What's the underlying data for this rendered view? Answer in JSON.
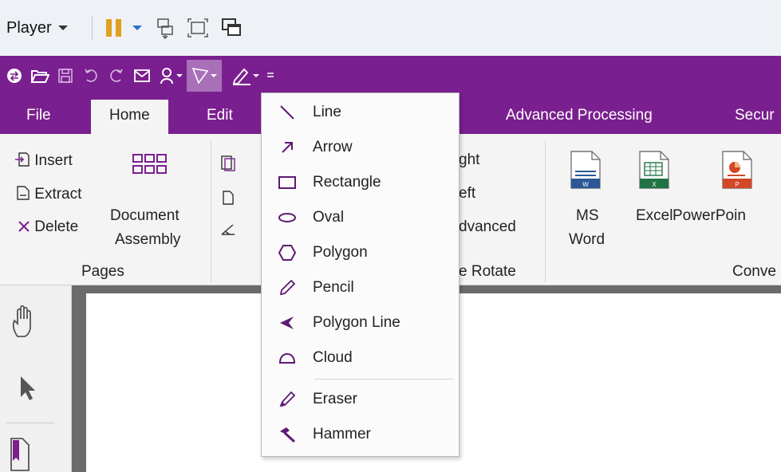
{
  "player_bar": {
    "player_label": "Player"
  },
  "tabs": [
    "File",
    "Home",
    "Edit",
    "Advanced Processing",
    "Secur"
  ],
  "ribbon": {
    "pages_group": {
      "insert": "Insert",
      "extract": "Extract",
      "delete": "Delete",
      "document": "Document",
      "assembly": "Assembly",
      "group_label": "Pages"
    },
    "rotate_group": {
      "right": "ght",
      "left": "eft",
      "advanced": "dvanced",
      "group_label": "e Rotate"
    },
    "convert_group": {
      "ms": "MS",
      "word": "Word",
      "excel": "Excel",
      "powerpoint": "PowerPoin",
      "group_label": "Conve"
    }
  },
  "dropdown": {
    "items": [
      {
        "label": "Line",
        "icon": "line-icon"
      },
      {
        "label": "Arrow",
        "icon": "arrow-icon"
      },
      {
        "label": "Rectangle",
        "icon": "rectangle-icon"
      },
      {
        "label": "Oval",
        "icon": "oval-icon"
      },
      {
        "label": "Polygon",
        "icon": "polygon-icon"
      },
      {
        "label": "Pencil",
        "icon": "pencil-icon"
      },
      {
        "label": "Polygon Line",
        "icon": "polygon-line-icon"
      },
      {
        "label": "Cloud",
        "icon": "cloud-icon"
      },
      {
        "label": "Eraser",
        "icon": "eraser-icon"
      },
      {
        "label": "Hammer",
        "icon": "hammer-icon"
      }
    ]
  },
  "colors": {
    "accent": "#7a1f8f",
    "selected_quick_tool": "#a870b8",
    "menu_icon": "#5e1a72"
  }
}
